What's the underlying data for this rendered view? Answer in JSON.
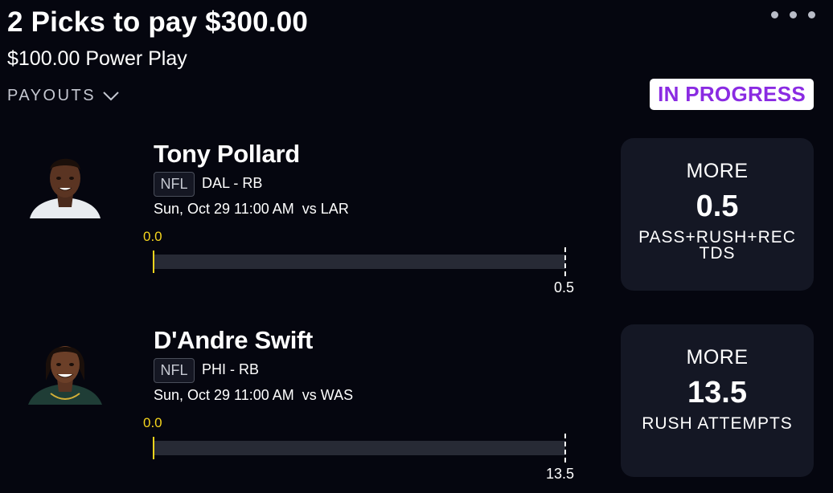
{
  "header": {
    "title": "2 Picks to pay $300.00",
    "subtitle": "$100.00 Power Play",
    "payouts_label": "PAYOUTS",
    "status": "IN PROGRESS"
  },
  "colors": {
    "background": "#05060f",
    "card": "#141724",
    "status_text": "#8a2be2",
    "progress": "#f5d51d"
  },
  "picks": [
    {
      "player_name": "Tony Pollard",
      "league": "NFL",
      "team_position": "DAL - RB",
      "game_time": "Sun, Oct 29 11:00 AM",
      "opponent": "vs LAR",
      "current_value": "0.0",
      "target_value": "0.5",
      "direction": "MORE",
      "line": "0.5",
      "stat": "PASS+RUSH+REC TDS",
      "progress_fraction": 0
    },
    {
      "player_name": "D'Andre Swift",
      "league": "NFL",
      "team_position": "PHI - RB",
      "game_time": "Sun, Oct 29 11:00 AM",
      "opponent": "vs WAS",
      "current_value": "0.0",
      "target_value": "13.5",
      "direction": "MORE",
      "line": "13.5",
      "stat": "RUSH ATTEMPTS",
      "progress_fraction": 0
    }
  ]
}
